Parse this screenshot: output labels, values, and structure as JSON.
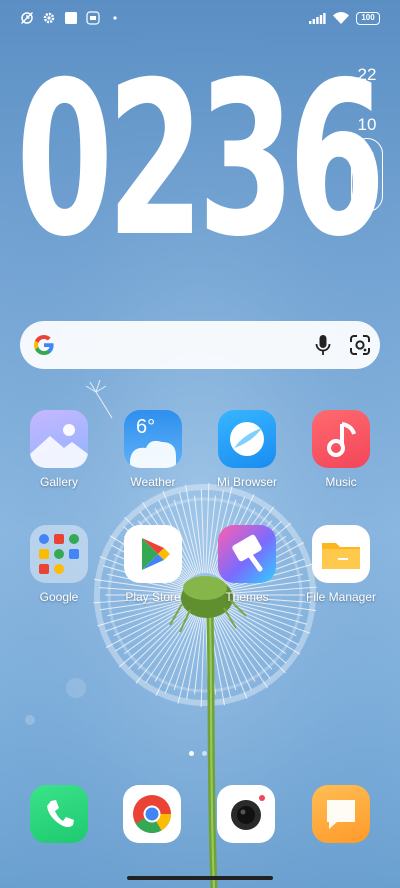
{
  "status_bar": {
    "icons_left": [
      "silent-clock-icon",
      "settings-gear-icon",
      "square-notification-icon",
      "mi-badge-icon",
      "dot-icon"
    ],
    "icons_right": [
      "signal-icon",
      "wifi-icon",
      "battery-icon"
    ],
    "battery": "100"
  },
  "clock": {
    "time": "0236",
    "day_of_month": "22",
    "separator": "/",
    "month": "10",
    "weekday": [
      "W",
      "e",
      "d"
    ]
  },
  "search_bar": {
    "icons": [
      "google-g-icon",
      "microphone-icon",
      "google-lens-icon"
    ]
  },
  "apps": [
    {
      "label": "Gallery"
    },
    {
      "label": "Weather",
      "temperature": "6°"
    },
    {
      "label": "Mi Browser"
    },
    {
      "label": "Music"
    },
    {
      "label": "Google"
    },
    {
      "label": "Play Store"
    },
    {
      "label": "Themes"
    },
    {
      "label": "File Manager"
    }
  ],
  "page_indicator": {
    "pages": 2,
    "current": 1
  },
  "dock": [
    {
      "icon": "phone-icon"
    },
    {
      "icon": "chrome-icon"
    },
    {
      "icon": "camera-icon"
    },
    {
      "icon": "messaging-icon"
    }
  ],
  "colors": {
    "sky": "#79a8d6",
    "phone_green": "#2ed47a",
    "music_red": "#f2465a",
    "message_orange": "#ffa93a",
    "folder_yellow": "#ffc12e"
  }
}
